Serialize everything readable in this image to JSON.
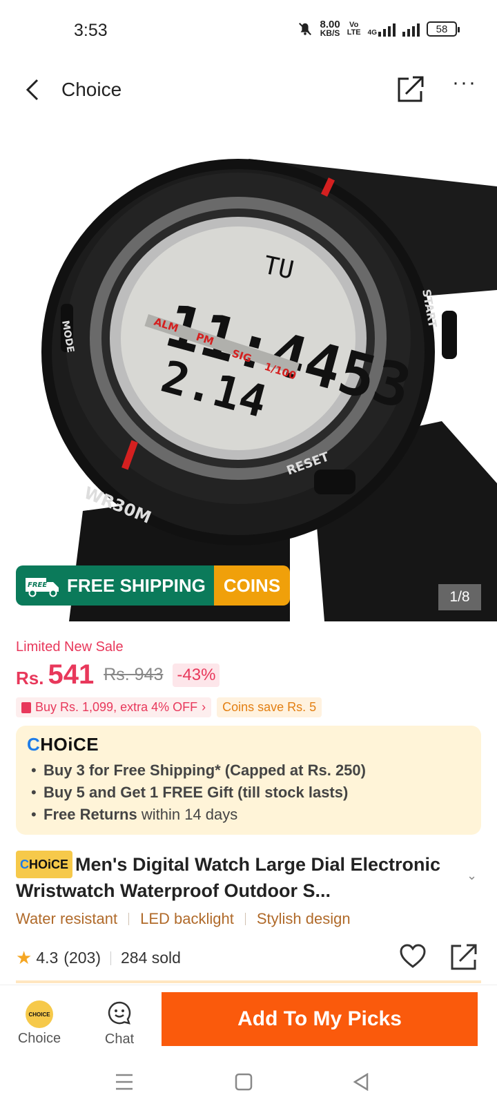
{
  "status_bar": {
    "time": "3:53",
    "speed_value": "8.00",
    "speed_unit": "KB/S",
    "volte_top": "Vo",
    "volte_bottom": "LTE",
    "network": "4G",
    "battery": "58"
  },
  "navbar": {
    "title": "Choice"
  },
  "gallery": {
    "free_shipping_label": "FREE SHIPPING",
    "coins_label": "COINS",
    "truck_tag": "FREE",
    "counter": "1/8"
  },
  "pricing": {
    "sale_label": "Limited New Sale",
    "currency": "Rs.",
    "price": "541",
    "original_price": "Rs. 943",
    "discount": "-43%",
    "promo_text": "Buy Rs. 1,099, extra 4% OFF",
    "coins_save": "Coins save Rs. 5"
  },
  "choice_box": {
    "logo_c": "C",
    "logo_rest": "HOiCE",
    "benefit_1": "Buy 3 for  Free Shipping* (Capped at Rs. 250)",
    "benefit_2": "Buy 5 and Get 1 FREE Gift (till stock lasts)",
    "benefit_3_bold": "Free Returns",
    "benefit_3_rest": " within 14 days"
  },
  "product": {
    "chip_c": "C",
    "chip_rest": "HOiCE",
    "title": "Men's Digital Watch Large Dial Electronic Wristwatch Waterproof Outdoor S...",
    "features": [
      "Water resistant",
      "LED backlight",
      "Stylish design"
    ],
    "rating": "4.3",
    "reviews": "(203)",
    "sold": "284 sold"
  },
  "bottom_bar": {
    "choice_icon_text": "CHOICE",
    "choice_label": "Choice",
    "chat_label": "Chat",
    "add_button": "Add To My Picks"
  },
  "watch_face": {
    "day": "TU",
    "time_digits": "11:4453",
    "date_digits": "2.14",
    "labels": [
      "ALM",
      "PM",
      "SIG",
      "1/100"
    ],
    "bezel_mode": "MODE",
    "bezel_start": "START",
    "bezel_reset": "RESET",
    "bezel_wr": "WR30M"
  },
  "colors": {
    "accent_orange": "#fa5a0c",
    "price_red": "#e8385b",
    "free_shipping_green": "#0b7a5a",
    "coins_amber": "#f0a00a"
  }
}
